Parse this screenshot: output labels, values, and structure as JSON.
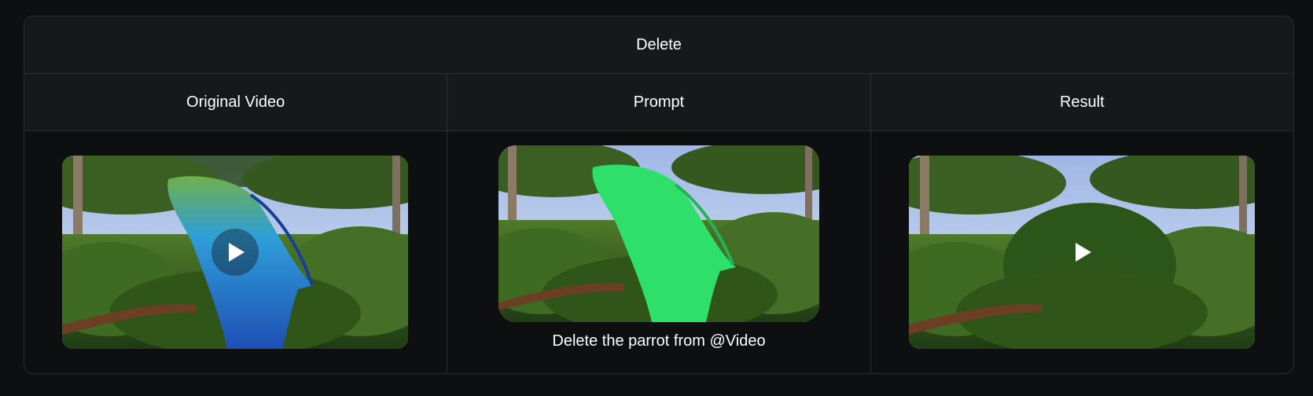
{
  "title": "Delete",
  "columns": {
    "original": "Original Video",
    "prompt": "Prompt",
    "result": "Result"
  },
  "prompt_text": "Delete the parrot from @Video",
  "icons": {
    "play": "play-icon"
  },
  "colors": {
    "background": "#0e0f10",
    "header_bg": "#17181a",
    "border": "#2b2d31",
    "text": "#ffffff",
    "highlight": "#2ee06a"
  }
}
